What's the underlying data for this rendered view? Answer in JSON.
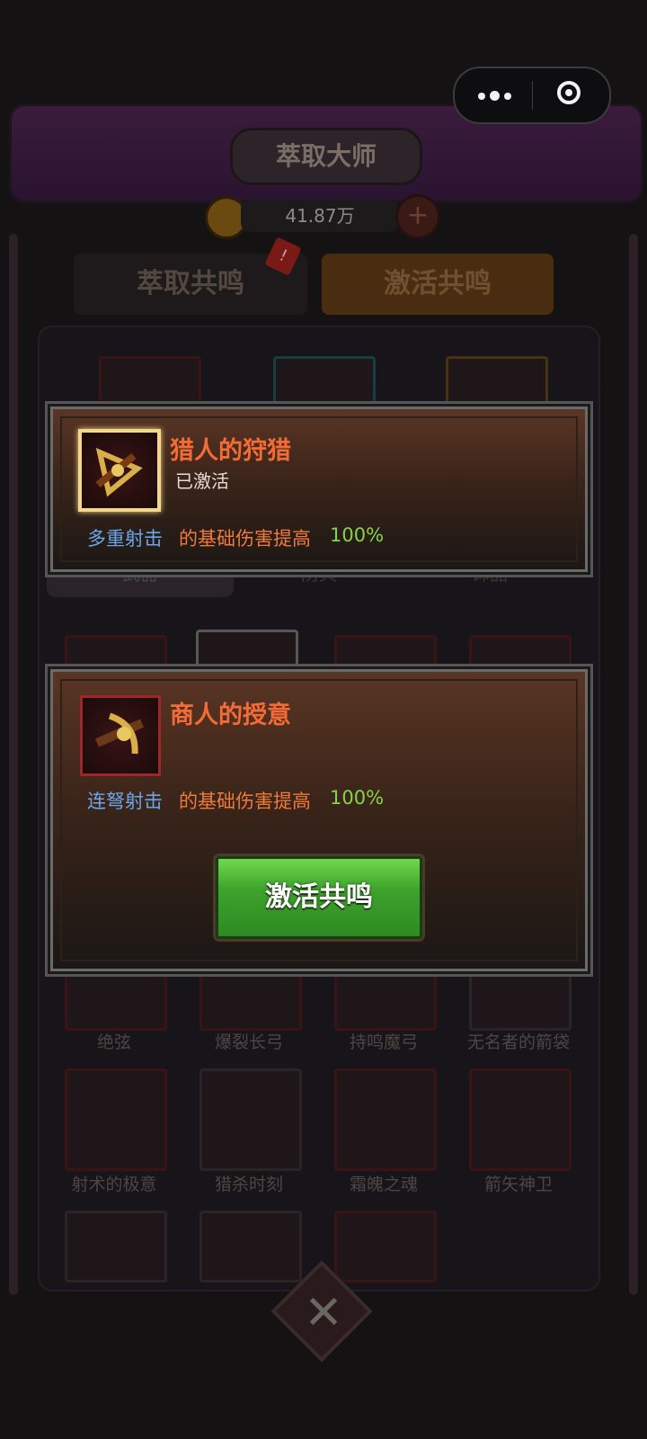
{
  "header": {
    "title": "萃取大师",
    "currency_value": "41.87万"
  },
  "tabs": [
    {
      "label": "萃取共鸣"
    },
    {
      "label": "激活共鸣"
    }
  ],
  "tab_badge": "!",
  "category_tabs": [
    {
      "label": "武器"
    },
    {
      "label": "防具"
    },
    {
      "label": "饰品"
    }
  ],
  "items": [
    {
      "name": "绝弦"
    },
    {
      "name": "爆裂长弓"
    },
    {
      "name": "持鸣魔弓"
    },
    {
      "name": "无名者的箭袋"
    },
    {
      "name": "射术的极意"
    },
    {
      "name": "猎杀时刻"
    },
    {
      "name": "霜魄之魂"
    },
    {
      "name": "箭矢神卫"
    }
  ],
  "popup_1": {
    "title": "猎人的狩猎",
    "status": "已激活",
    "skill": "多重射击",
    "effect": "的基础伤害提高",
    "percent": "100%"
  },
  "popup_2": {
    "title": "商人的授意",
    "skill": "连弩射击",
    "effect": "的基础伤害提高",
    "percent": "100%",
    "button_label": "激活共鸣"
  },
  "colors": {
    "title_orange": "#f36b37",
    "skill_blue": "#6aa6e8",
    "percent_green": "#82d449",
    "button_green": "#3ea32c",
    "gold_frame": "#f3d88a"
  }
}
